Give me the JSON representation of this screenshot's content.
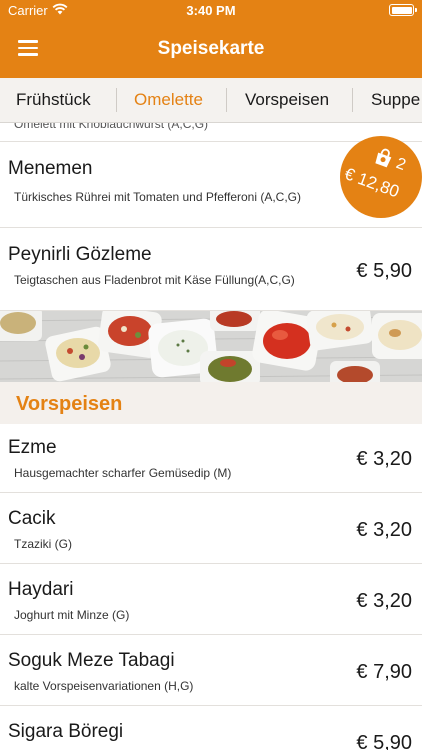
{
  "status_bar": {
    "carrier": "Carrier",
    "time": "3:40 PM"
  },
  "nav": {
    "title": "Speisekarte"
  },
  "tabs": [
    {
      "label": "Frühstück"
    },
    {
      "label": "Omelette",
      "active": true
    },
    {
      "label": "Vorspeisen"
    },
    {
      "label": "Suppe"
    }
  ],
  "partial_row": {
    "text": "Omelett mit Knoblauchwurst (A,C,G)"
  },
  "items_top": [
    {
      "name": "Menemen",
      "desc": "Türkisches Rührei mit Tomaten und Pfefferoni (A,C,G)",
      "price": ""
    },
    {
      "name": "Peynirli Gözleme",
      "desc": "Teigtaschen aus Fladenbrot mit Käse Füllung(A,C,G)",
      "price": "€ 5,90"
    }
  ],
  "section": {
    "title": "Vorspeisen"
  },
  "items_bottom": [
    {
      "name": "Ezme",
      "desc": "Hausgemachter scharfer Gemüsedip (M)",
      "price": "€ 3,20"
    },
    {
      "name": "Cacik",
      "desc": "Tzaziki (G)",
      "price": "€ 3,20"
    },
    {
      "name": "Haydari",
      "desc": "Joghurt mit Minze (G)",
      "price": "€ 3,20"
    },
    {
      "name": "Soguk Meze Tabagi",
      "desc": "kalte Vorspeisenvariationen (H,G)",
      "price": "€ 7,90"
    },
    {
      "name": "Sigara Böregi",
      "desc": "",
      "price": "€ 5,90"
    }
  ],
  "cart": {
    "count": "2",
    "total": "€ 12,80"
  },
  "colors": {
    "accent": "#e48214",
    "section_bg": "#f4f0ec",
    "tabs_bg": "#f4f2ef"
  }
}
